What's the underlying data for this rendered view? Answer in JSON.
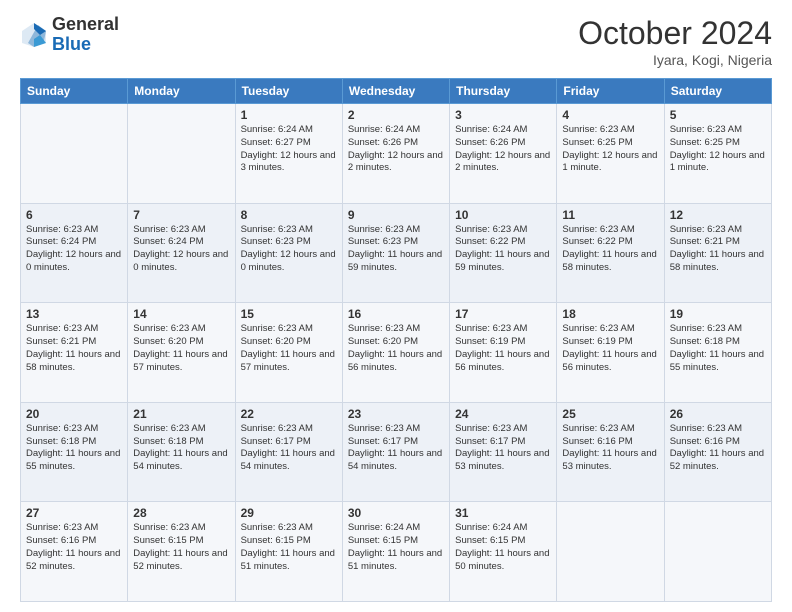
{
  "header": {
    "logo": {
      "general": "General",
      "blue": "Blue"
    },
    "title": "October 2024",
    "location": "Iyara, Kogi, Nigeria"
  },
  "calendar": {
    "headers": [
      "Sunday",
      "Monday",
      "Tuesday",
      "Wednesday",
      "Thursday",
      "Friday",
      "Saturday"
    ],
    "weeks": [
      [
        {
          "day": "",
          "info": ""
        },
        {
          "day": "",
          "info": ""
        },
        {
          "day": "1",
          "info": "Sunrise: 6:24 AM\nSunset: 6:27 PM\nDaylight: 12 hours and 3 minutes."
        },
        {
          "day": "2",
          "info": "Sunrise: 6:24 AM\nSunset: 6:26 PM\nDaylight: 12 hours and 2 minutes."
        },
        {
          "day": "3",
          "info": "Sunrise: 6:24 AM\nSunset: 6:26 PM\nDaylight: 12 hours and 2 minutes."
        },
        {
          "day": "4",
          "info": "Sunrise: 6:23 AM\nSunset: 6:25 PM\nDaylight: 12 hours and 1 minute."
        },
        {
          "day": "5",
          "info": "Sunrise: 6:23 AM\nSunset: 6:25 PM\nDaylight: 12 hours and 1 minute."
        }
      ],
      [
        {
          "day": "6",
          "info": "Sunrise: 6:23 AM\nSunset: 6:24 PM\nDaylight: 12 hours and 0 minutes."
        },
        {
          "day": "7",
          "info": "Sunrise: 6:23 AM\nSunset: 6:24 PM\nDaylight: 12 hours and 0 minutes."
        },
        {
          "day": "8",
          "info": "Sunrise: 6:23 AM\nSunset: 6:23 PM\nDaylight: 12 hours and 0 minutes."
        },
        {
          "day": "9",
          "info": "Sunrise: 6:23 AM\nSunset: 6:23 PM\nDaylight: 11 hours and 59 minutes."
        },
        {
          "day": "10",
          "info": "Sunrise: 6:23 AM\nSunset: 6:22 PM\nDaylight: 11 hours and 59 minutes."
        },
        {
          "day": "11",
          "info": "Sunrise: 6:23 AM\nSunset: 6:22 PM\nDaylight: 11 hours and 58 minutes."
        },
        {
          "day": "12",
          "info": "Sunrise: 6:23 AM\nSunset: 6:21 PM\nDaylight: 11 hours and 58 minutes."
        }
      ],
      [
        {
          "day": "13",
          "info": "Sunrise: 6:23 AM\nSunset: 6:21 PM\nDaylight: 11 hours and 58 minutes."
        },
        {
          "day": "14",
          "info": "Sunrise: 6:23 AM\nSunset: 6:20 PM\nDaylight: 11 hours and 57 minutes."
        },
        {
          "day": "15",
          "info": "Sunrise: 6:23 AM\nSunset: 6:20 PM\nDaylight: 11 hours and 57 minutes."
        },
        {
          "day": "16",
          "info": "Sunrise: 6:23 AM\nSunset: 6:20 PM\nDaylight: 11 hours and 56 minutes."
        },
        {
          "day": "17",
          "info": "Sunrise: 6:23 AM\nSunset: 6:19 PM\nDaylight: 11 hours and 56 minutes."
        },
        {
          "day": "18",
          "info": "Sunrise: 6:23 AM\nSunset: 6:19 PM\nDaylight: 11 hours and 56 minutes."
        },
        {
          "day": "19",
          "info": "Sunrise: 6:23 AM\nSunset: 6:18 PM\nDaylight: 11 hours and 55 minutes."
        }
      ],
      [
        {
          "day": "20",
          "info": "Sunrise: 6:23 AM\nSunset: 6:18 PM\nDaylight: 11 hours and 55 minutes."
        },
        {
          "day": "21",
          "info": "Sunrise: 6:23 AM\nSunset: 6:18 PM\nDaylight: 11 hours and 54 minutes."
        },
        {
          "day": "22",
          "info": "Sunrise: 6:23 AM\nSunset: 6:17 PM\nDaylight: 11 hours and 54 minutes."
        },
        {
          "day": "23",
          "info": "Sunrise: 6:23 AM\nSunset: 6:17 PM\nDaylight: 11 hours and 54 minutes."
        },
        {
          "day": "24",
          "info": "Sunrise: 6:23 AM\nSunset: 6:17 PM\nDaylight: 11 hours and 53 minutes."
        },
        {
          "day": "25",
          "info": "Sunrise: 6:23 AM\nSunset: 6:16 PM\nDaylight: 11 hours and 53 minutes."
        },
        {
          "day": "26",
          "info": "Sunrise: 6:23 AM\nSunset: 6:16 PM\nDaylight: 11 hours and 52 minutes."
        }
      ],
      [
        {
          "day": "27",
          "info": "Sunrise: 6:23 AM\nSunset: 6:16 PM\nDaylight: 11 hours and 52 minutes."
        },
        {
          "day": "28",
          "info": "Sunrise: 6:23 AM\nSunset: 6:15 PM\nDaylight: 11 hours and 52 minutes."
        },
        {
          "day": "29",
          "info": "Sunrise: 6:23 AM\nSunset: 6:15 PM\nDaylight: 11 hours and 51 minutes."
        },
        {
          "day": "30",
          "info": "Sunrise: 6:24 AM\nSunset: 6:15 PM\nDaylight: 11 hours and 51 minutes."
        },
        {
          "day": "31",
          "info": "Sunrise: 6:24 AM\nSunset: 6:15 PM\nDaylight: 11 hours and 50 minutes."
        },
        {
          "day": "",
          "info": ""
        },
        {
          "day": "",
          "info": ""
        }
      ]
    ]
  }
}
